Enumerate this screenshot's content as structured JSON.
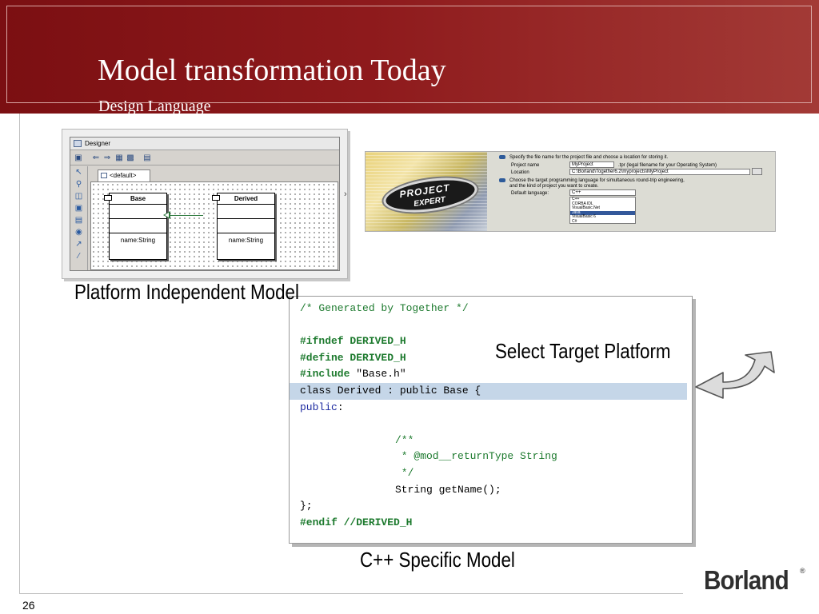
{
  "slide": {
    "title": "Model transformation Today",
    "subtitle": "Design Language",
    "page_number": "26"
  },
  "designer": {
    "window_title": "Designer",
    "tab_label": "<default>",
    "classes": [
      {
        "name": "Base",
        "attribute": "name:String"
      },
      {
        "name": "Derived",
        "attribute": "name:String"
      }
    ]
  },
  "project_expert": {
    "logo_line1": "PROJECT",
    "logo_line2": "EXPERT",
    "instruction_1": "Specify the file name for the project file and choose a location for storing it.",
    "project_name_label": "Project name",
    "project_name_value": "MyProject",
    "project_name_hint": ".tpr (legal filename for your Operating System)",
    "location_label": "Location",
    "location_value": "C:\\Borland\\Together6.2\\myprojects\\MyProject",
    "instruction_2a": "Choose the target programming language for simultaneous round-trip engineering,",
    "instruction_2b": "and the kind of project you want to create.",
    "default_language_label": "Default language:",
    "default_language_value": "C++",
    "language_options": [
      "C++",
      "CORBA IDL",
      "VisualBasic.Net",
      "Java",
      "VisualBasic 6",
      "C#"
    ],
    "selected_option": "Java"
  },
  "labels": {
    "pim": "Platform Independent Model",
    "select_target": "Select Target Platform",
    "cpp_model": "C++ Specific Model"
  },
  "code": {
    "line1": "/* Generated by Together */",
    "ifndef_kw": "#ifndef",
    "ifndef_val": " DERIVED_H",
    "define_kw": "#define",
    "define_val": " DERIVED_H",
    "include_kw": "#include",
    "include_val": " \"Base.h\"",
    "class_line": "class Derived : public Base {",
    "public_kw": "public",
    "public_colon": ":",
    "doc1": "/**",
    "doc2": " * @mod__returnType String",
    "doc3": " */",
    "method": "String getName();",
    "close": "};",
    "endif_kw": "#endif",
    "endif_comment": " //DERIVED_H"
  },
  "brand": {
    "logo_text": "Borland",
    "registered": "®"
  },
  "colors": {
    "header_red": "#8e1a1c",
    "code_comment_green": "#1d7a2e",
    "code_highlight": "#c5d6e8"
  }
}
